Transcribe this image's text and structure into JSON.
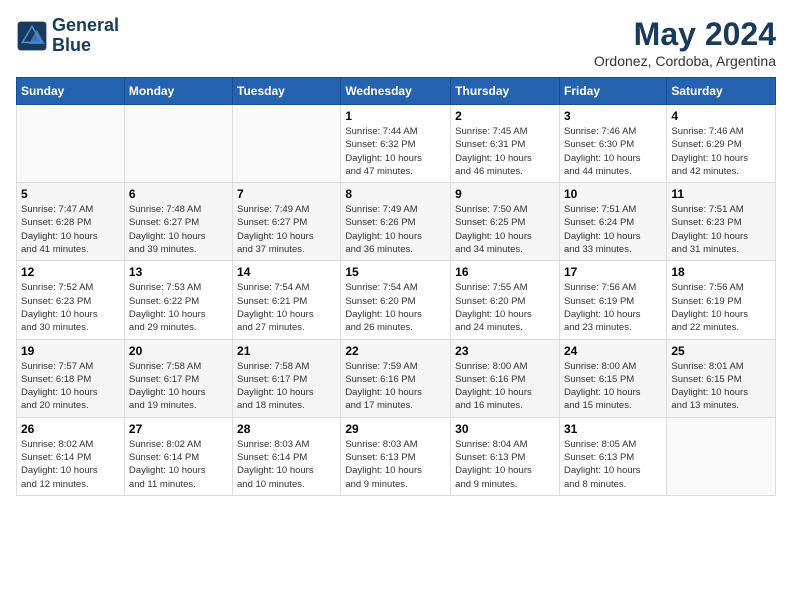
{
  "header": {
    "logo_line1": "General",
    "logo_line2": "Blue",
    "month_year": "May 2024",
    "location": "Ordonez, Cordoba, Argentina"
  },
  "weekdays": [
    "Sunday",
    "Monday",
    "Tuesday",
    "Wednesday",
    "Thursday",
    "Friday",
    "Saturday"
  ],
  "weeks": [
    [
      {
        "day": "",
        "info": ""
      },
      {
        "day": "",
        "info": ""
      },
      {
        "day": "",
        "info": ""
      },
      {
        "day": "1",
        "info": "Sunrise: 7:44 AM\nSunset: 6:32 PM\nDaylight: 10 hours\nand 47 minutes."
      },
      {
        "day": "2",
        "info": "Sunrise: 7:45 AM\nSunset: 6:31 PM\nDaylight: 10 hours\nand 46 minutes."
      },
      {
        "day": "3",
        "info": "Sunrise: 7:46 AM\nSunset: 6:30 PM\nDaylight: 10 hours\nand 44 minutes."
      },
      {
        "day": "4",
        "info": "Sunrise: 7:46 AM\nSunset: 6:29 PM\nDaylight: 10 hours\nand 42 minutes."
      }
    ],
    [
      {
        "day": "5",
        "info": "Sunrise: 7:47 AM\nSunset: 6:28 PM\nDaylight: 10 hours\nand 41 minutes."
      },
      {
        "day": "6",
        "info": "Sunrise: 7:48 AM\nSunset: 6:27 PM\nDaylight: 10 hours\nand 39 minutes."
      },
      {
        "day": "7",
        "info": "Sunrise: 7:49 AM\nSunset: 6:27 PM\nDaylight: 10 hours\nand 37 minutes."
      },
      {
        "day": "8",
        "info": "Sunrise: 7:49 AM\nSunset: 6:26 PM\nDaylight: 10 hours\nand 36 minutes."
      },
      {
        "day": "9",
        "info": "Sunrise: 7:50 AM\nSunset: 6:25 PM\nDaylight: 10 hours\nand 34 minutes."
      },
      {
        "day": "10",
        "info": "Sunrise: 7:51 AM\nSunset: 6:24 PM\nDaylight: 10 hours\nand 33 minutes."
      },
      {
        "day": "11",
        "info": "Sunrise: 7:51 AM\nSunset: 6:23 PM\nDaylight: 10 hours\nand 31 minutes."
      }
    ],
    [
      {
        "day": "12",
        "info": "Sunrise: 7:52 AM\nSunset: 6:23 PM\nDaylight: 10 hours\nand 30 minutes."
      },
      {
        "day": "13",
        "info": "Sunrise: 7:53 AM\nSunset: 6:22 PM\nDaylight: 10 hours\nand 29 minutes."
      },
      {
        "day": "14",
        "info": "Sunrise: 7:54 AM\nSunset: 6:21 PM\nDaylight: 10 hours\nand 27 minutes."
      },
      {
        "day": "15",
        "info": "Sunrise: 7:54 AM\nSunset: 6:20 PM\nDaylight: 10 hours\nand 26 minutes."
      },
      {
        "day": "16",
        "info": "Sunrise: 7:55 AM\nSunset: 6:20 PM\nDaylight: 10 hours\nand 24 minutes."
      },
      {
        "day": "17",
        "info": "Sunrise: 7:56 AM\nSunset: 6:19 PM\nDaylight: 10 hours\nand 23 minutes."
      },
      {
        "day": "18",
        "info": "Sunrise: 7:56 AM\nSunset: 6:19 PM\nDaylight: 10 hours\nand 22 minutes."
      }
    ],
    [
      {
        "day": "19",
        "info": "Sunrise: 7:57 AM\nSunset: 6:18 PM\nDaylight: 10 hours\nand 20 minutes."
      },
      {
        "day": "20",
        "info": "Sunrise: 7:58 AM\nSunset: 6:17 PM\nDaylight: 10 hours\nand 19 minutes."
      },
      {
        "day": "21",
        "info": "Sunrise: 7:58 AM\nSunset: 6:17 PM\nDaylight: 10 hours\nand 18 minutes."
      },
      {
        "day": "22",
        "info": "Sunrise: 7:59 AM\nSunset: 6:16 PM\nDaylight: 10 hours\nand 17 minutes."
      },
      {
        "day": "23",
        "info": "Sunrise: 8:00 AM\nSunset: 6:16 PM\nDaylight: 10 hours\nand 16 minutes."
      },
      {
        "day": "24",
        "info": "Sunrise: 8:00 AM\nSunset: 6:15 PM\nDaylight: 10 hours\nand 15 minutes."
      },
      {
        "day": "25",
        "info": "Sunrise: 8:01 AM\nSunset: 6:15 PM\nDaylight: 10 hours\nand 13 minutes."
      }
    ],
    [
      {
        "day": "26",
        "info": "Sunrise: 8:02 AM\nSunset: 6:14 PM\nDaylight: 10 hours\nand 12 minutes."
      },
      {
        "day": "27",
        "info": "Sunrise: 8:02 AM\nSunset: 6:14 PM\nDaylight: 10 hours\nand 11 minutes."
      },
      {
        "day": "28",
        "info": "Sunrise: 8:03 AM\nSunset: 6:14 PM\nDaylight: 10 hours\nand 10 minutes."
      },
      {
        "day": "29",
        "info": "Sunrise: 8:03 AM\nSunset: 6:13 PM\nDaylight: 10 hours\nand 9 minutes."
      },
      {
        "day": "30",
        "info": "Sunrise: 8:04 AM\nSunset: 6:13 PM\nDaylight: 10 hours\nand 9 minutes."
      },
      {
        "day": "31",
        "info": "Sunrise: 8:05 AM\nSunset: 6:13 PM\nDaylight: 10 hours\nand 8 minutes."
      },
      {
        "day": "",
        "info": ""
      }
    ]
  ]
}
